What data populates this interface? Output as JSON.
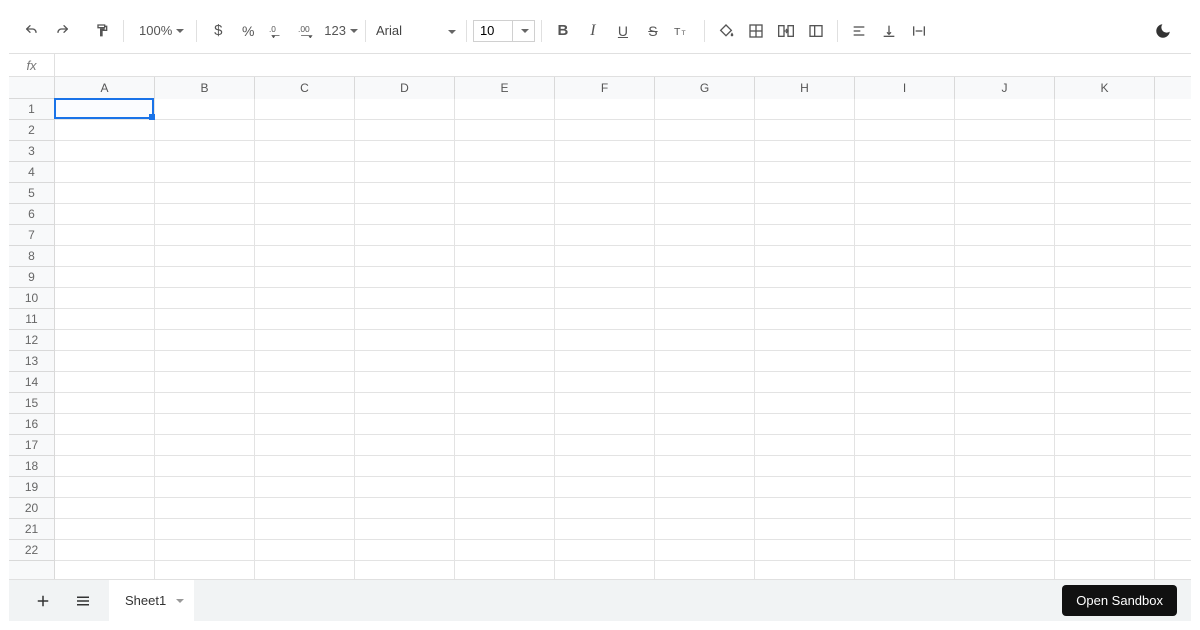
{
  "toolbar": {
    "zoom": "100%",
    "number_format_label": "123",
    "font_name": "Arial",
    "font_size": "10"
  },
  "formula_bar": {
    "fx_label": "fx",
    "value": ""
  },
  "grid": {
    "columns": [
      "A",
      "B",
      "C",
      "D",
      "E",
      "F",
      "G",
      "H",
      "I",
      "J",
      "K"
    ],
    "rows": [
      "1",
      "2",
      "3",
      "4",
      "5",
      "6",
      "7",
      "8",
      "9",
      "10",
      "11",
      "12",
      "13",
      "14",
      "15",
      "16",
      "17",
      "18",
      "19",
      "20",
      "21",
      "22"
    ],
    "selected_cell": {
      "col": 0,
      "row": 0
    }
  },
  "sheet_bar": {
    "tab_name": "Sheet1"
  },
  "sandbox": {
    "button_label": "Open Sandbox"
  }
}
